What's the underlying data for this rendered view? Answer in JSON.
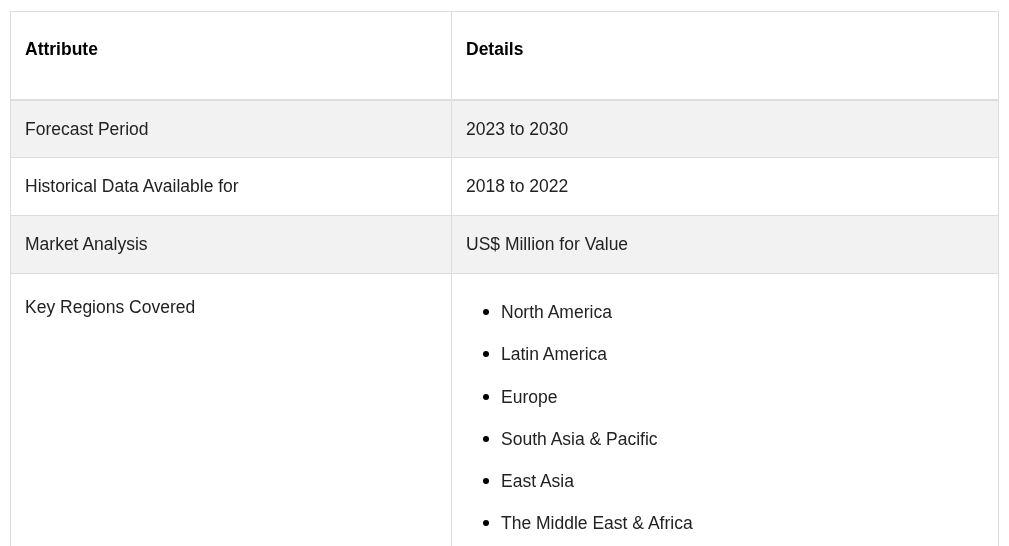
{
  "table": {
    "columns": [
      "Attribute",
      "Details"
    ],
    "rows": [
      {
        "attribute": "Forecast Period",
        "details": "2023 to 2030",
        "kind": "text"
      },
      {
        "attribute": "Historical Data Available for",
        "details": "2018 to 2022",
        "kind": "text"
      },
      {
        "attribute": "Market Analysis",
        "details": "US$ Million for Value",
        "kind": "text"
      },
      {
        "attribute": "Key Regions Covered",
        "kind": "list",
        "items": [
          "North America",
          "Latin America",
          "Europe",
          "South Asia & Pacific",
          "East Asia",
          "The Middle East & Africa"
        ]
      }
    ]
  }
}
